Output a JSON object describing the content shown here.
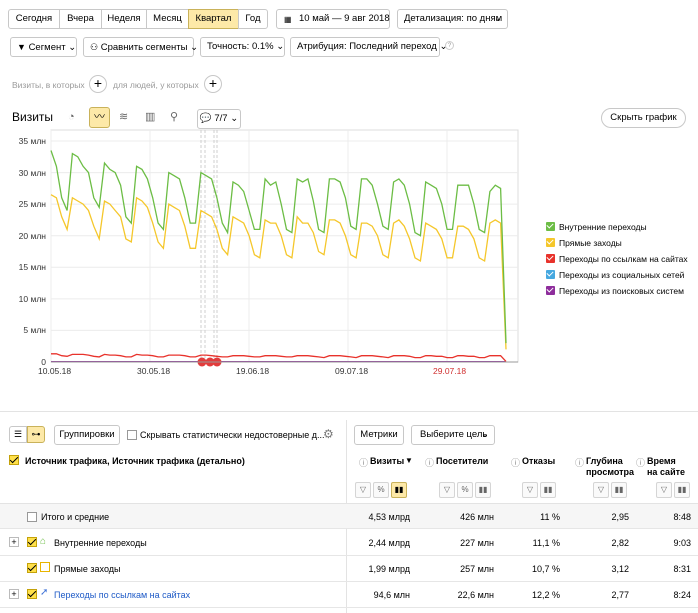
{
  "period_tabs": [
    "Сегодня",
    "Вчера",
    "Неделя",
    "Месяц",
    "Квартал",
    "Год"
  ],
  "date_range": "10 май — 9 авг 2018",
  "detail": "Детализация: по дням",
  "toolbar2": {
    "segment": "Сегмент",
    "compare": "Сравнить сегменты",
    "accuracy": "Точность: 0.1%",
    "attribution": "Атрибуция: Последний переход"
  },
  "filters": {
    "visits_who": "Визиты, в которых",
    "people_who": "для людей, у которых"
  },
  "chart_header": {
    "title": "Визиты",
    "notes": "7/7",
    "hide": "Скрыть график"
  },
  "chart_data": {
    "type": "line",
    "ylabels": [
      "35 млн",
      "30 млн",
      "25 млн",
      "20 млн",
      "15 млн",
      "10 млн",
      "5 млн",
      "0"
    ],
    "xlabels": [
      "10.05.18",
      "30.05.18",
      "19.06.18",
      "09.07.18",
      "29.07.18"
    ],
    "ylim": [
      0,
      35
    ],
    "series": [
      {
        "name": "Внутренние переходы",
        "color": "#6cbd45",
        "values": [
          33.5,
          31,
          26,
          24,
          33,
          32.5,
          31,
          30,
          26,
          24.5,
          31.5,
          30.5,
          30,
          28,
          23,
          22,
          31,
          30.5,
          29,
          26,
          22,
          21,
          30,
          29.5,
          29,
          26,
          22,
          22,
          30,
          29.5,
          29,
          26,
          22,
          20.5,
          28.5,
          28,
          27,
          24,
          21,
          21,
          29,
          28,
          28.5,
          25,
          21,
          20.5,
          29,
          28.5,
          29,
          25.5,
          21,
          20.5,
          29,
          29,
          28.5,
          26,
          21.5,
          21,
          29,
          29,
          28,
          25,
          21.5,
          21,
          28.5,
          29,
          28,
          25,
          20.5,
          20,
          28.5,
          28,
          27.5,
          25,
          21,
          21,
          28,
          28,
          28,
          25,
          21,
          20.5,
          27,
          28,
          27.5,
          3
        ]
      },
      {
        "name": "Прямые заходы",
        "color": "#f5c72b",
        "values": [
          26.5,
          26,
          23,
          21,
          26,
          25.5,
          25,
          24,
          21.5,
          19.5,
          25.5,
          25,
          24,
          23,
          19.5,
          19,
          26,
          25.5,
          24.5,
          22,
          19,
          18,
          25,
          24.5,
          24,
          21.5,
          18,
          18,
          24,
          23.5,
          23,
          21,
          18,
          17,
          23,
          22.5,
          22,
          20,
          17,
          16.5,
          22.5,
          22,
          22,
          20,
          17,
          16.5,
          23,
          22,
          22,
          20.5,
          17.5,
          17,
          22.5,
          22.5,
          22,
          20,
          17,
          16.5,
          22,
          22,
          21.5,
          20,
          17,
          16.5,
          22,
          22.5,
          21.5,
          19.5,
          16.5,
          16,
          22,
          21.5,
          21,
          19.5,
          16.5,
          16.5,
          21.5,
          21.5,
          21,
          19.5,
          16.5,
          16,
          22,
          22.5,
          22,
          2
        ]
      },
      {
        "name": "Переходы по ссылкам на сайтах",
        "color": "#e8322b",
        "values": [
          1.3,
          1.3,
          1.0,
          0.9,
          1.2,
          1.2,
          1.2,
          1.1,
          0.9,
          0.8,
          1.2,
          1.1,
          1.1,
          1.0,
          0.8,
          0.8,
          1.2,
          1.1,
          1.1,
          1.0,
          0.8,
          0.8,
          1.1,
          1.1,
          1.1,
          1.0,
          0.8,
          0.8,
          1.1,
          1.1,
          1.0,
          0.9,
          0.8,
          0.8,
          1.0,
          1.0,
          1.0,
          0.9,
          0.8,
          0.8,
          1.0,
          1.0,
          1.0,
          0.9,
          0.8,
          0.8,
          1.0,
          1.0,
          1.0,
          0.9,
          0.8,
          0.7,
          1.0,
          1.0,
          1.0,
          0.9,
          0.8,
          0.7,
          1.0,
          1.0,
          1.0,
          0.9,
          0.8,
          0.7,
          1.0,
          1.0,
          1.0,
          0.9,
          0.7,
          0.7,
          1.0,
          1.0,
          0.9,
          0.9,
          0.7,
          0.7,
          1.0,
          1.0,
          0.9,
          0.9,
          0.7,
          0.7,
          1.0,
          1.0,
          1.0,
          0.1
        ]
      },
      {
        "name": "Переходы из социальных сетей",
        "color": "#46a8e0",
        "values": [
          0.05,
          0.05
        ]
      },
      {
        "name": "Переходы из поисковых систем",
        "color": "#8e2d9c",
        "values": [
          0.05,
          0.05
        ]
      }
    ]
  },
  "table": {
    "tabs": [
      "Группировки"
    ],
    "hide_unreliable": "Скрывать статистически недостоверные д...",
    "metrics_btn": "Метрики",
    "goal_btn": "Выберите цель",
    "dim_header": "Источник трафика, Источник трафика (детально)",
    "columns": [
      "Визиты",
      "Посетители",
      "Отказы",
      "Глубина просмотра",
      "Время на сайте"
    ],
    "totals": {
      "label": "Итого и средние",
      "values": [
        "4,53 млрд",
        "426 млн",
        "11 %",
        "2,95",
        "8:48"
      ]
    },
    "rows": [
      {
        "label": "Внутренние переходы",
        "values": [
          "2,44 млрд",
          "227 млн",
          "11,1 %",
          "2,82",
          "9:03"
        ],
        "bars": [
          0.54,
          0.53,
          0.6,
          0.55,
          0.62
        ]
      },
      {
        "label": "Прямые заходы",
        "values": [
          "1,99 млрд",
          "257 млн",
          "10,7 %",
          "3,12",
          "8:31"
        ],
        "bars": [
          0.44,
          0.6,
          0.58,
          0.6,
          0.58
        ]
      },
      {
        "label": "Переходы по ссылкам на сайтах",
        "values": [
          "94,6 млн",
          "22,6 млн",
          "12,2 %",
          "2,77",
          "8:24"
        ],
        "bars": [
          0.03,
          0.06,
          0.66,
          0.54,
          0.57
        ]
      }
    ]
  }
}
